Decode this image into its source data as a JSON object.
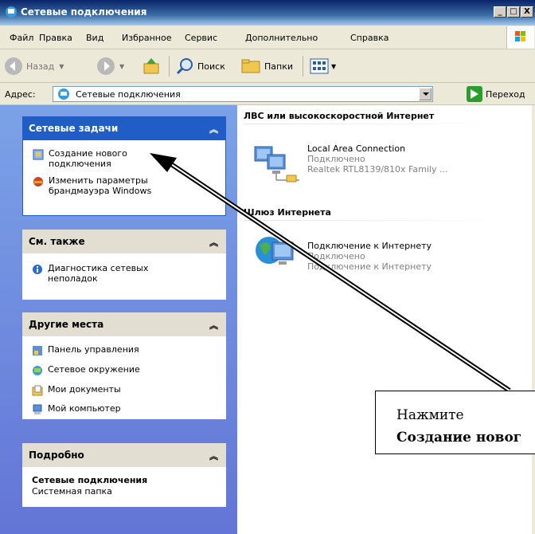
{
  "window": {
    "title": "Сетевые подключения",
    "title_icon": "network-connections-icon",
    "buttons": {
      "minimize": "_",
      "maximize": "□",
      "close": "X"
    }
  },
  "menu": {
    "items": [
      "Файл",
      "Правка",
      "Вид",
      "Избранное",
      "Сервис",
      "Дополнительно",
      "Справка"
    ],
    "logo_icon": "windows-flag-icon"
  },
  "toolbar": {
    "back_label": "Назад",
    "search_label": "Поиск",
    "folders_label": "Папки",
    "icons": [
      "back-arrow-icon",
      "forward-arrow-icon",
      "up-folder-icon",
      "search-icon",
      "folders-icon",
      "views-icon"
    ]
  },
  "address": {
    "label": "Адрес:",
    "value": "Сетевые подключения",
    "go_label": "Переход"
  },
  "left": {
    "network_tasks": {
      "title": "Сетевые задачи",
      "items": [
        "Создание нового подключения",
        "Изменить параметры брандмауэра Windows"
      ]
    },
    "see_also": {
      "title": "См. также",
      "items": [
        "Диагностика сетевых неполадок"
      ]
    },
    "other_places": {
      "title": "Другие места",
      "items": [
        "Панель управления",
        "Сетевое окружение",
        "Мои документы",
        "Мой компьютер"
      ]
    },
    "details": {
      "title": "Подробно",
      "name": "Сетевые подключения",
      "type": "Системная папка"
    }
  },
  "right": {
    "group1": {
      "title": "ЛВС или высокоскоростной Интернет",
      "connection": {
        "name": "Local Area Connection",
        "status": "Подключено",
        "device": "Realtek RTL8139/810x Family ..."
      }
    },
    "group2": {
      "title": "Шлюз Интернета",
      "connection": {
        "name": "Подключение к Интернету",
        "status": "Подключено",
        "device": "Подключение к Интернету"
      }
    }
  },
  "callout": {
    "line1": "Нажмите",
    "line2": "Создание новог"
  },
  "colors": {
    "titlebar": "#0a246a",
    "panel_blue": "#215dc6",
    "pane_bg": "#7ba2e7"
  }
}
